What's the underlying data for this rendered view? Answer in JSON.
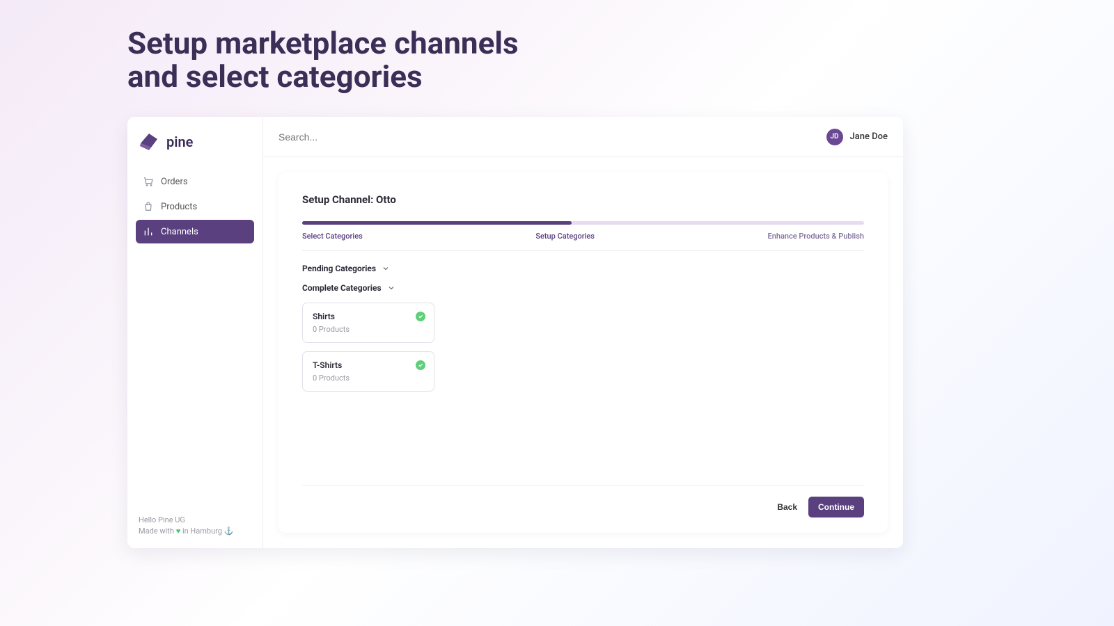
{
  "hero": {
    "line1": "Setup marketplace channels",
    "line2": "and select categories"
  },
  "brand": {
    "name": "pine"
  },
  "sidebar": {
    "items": [
      {
        "label": "Orders",
        "icon": "cart-icon",
        "active": false
      },
      {
        "label": "Products",
        "icon": "bag-icon",
        "active": false
      },
      {
        "label": "Channels",
        "icon": "bars-icon",
        "active": true
      }
    ],
    "footer1": "Hello Pine UG",
    "footer2_pre": "Made with ",
    "footer2_mid": " in Hamburg ",
    "footer_heart": "♥",
    "footer_anchor": "⚓"
  },
  "topbar": {
    "search_placeholder": "Search..."
  },
  "user": {
    "initials": "JD",
    "name": "Jane Doe"
  },
  "card": {
    "title": "Setup Channel: Otto",
    "progress_pct": 48,
    "steps": {
      "a": "Select Categories",
      "b": "Setup Categories",
      "c": "Enhance Products & Publish"
    },
    "pending_hdr": "Pending Categories",
    "complete_hdr": "Complete Categories",
    "categories": [
      {
        "name": "Shirts",
        "sub": "0 Products"
      },
      {
        "name": "T-Shirts",
        "sub": "0 Products"
      }
    ],
    "back": "Back",
    "continue": "Continue"
  }
}
